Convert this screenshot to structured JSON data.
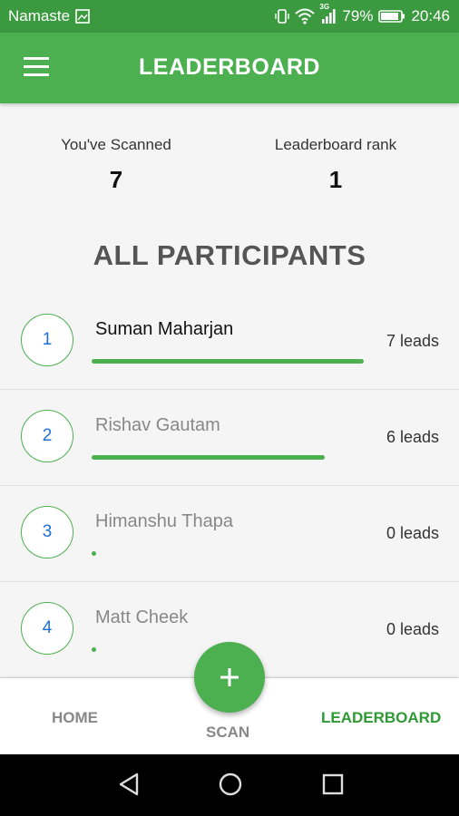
{
  "status_bar": {
    "carrier": "Namaste",
    "battery": "79%",
    "time": "20:46",
    "network_type": "3G"
  },
  "app_bar": {
    "title": "LEADERBOARD"
  },
  "stats": {
    "scanned_label": "You've Scanned",
    "scanned_value": "7",
    "rank_label": "Leaderboard rank",
    "rank_value": "1"
  },
  "section_title": "ALL PARTICIPANTS",
  "participants": [
    {
      "rank": "1",
      "name": "Suman Maharjan",
      "leads_text": "7 leads",
      "leads": 7
    },
    {
      "rank": "2",
      "name": "Rishav Gautam",
      "leads_text": "6 leads",
      "leads": 6
    },
    {
      "rank": "3",
      "name": "Himanshu Thapa",
      "leads_text": "0 leads",
      "leads": 0
    },
    {
      "rank": "4",
      "name": "Matt Cheek",
      "leads_text": "0 leads",
      "leads": 0
    }
  ],
  "bottom_nav": {
    "home": "HOME",
    "scan": "SCAN",
    "leaderboard": "LEADERBOARD"
  },
  "colors": {
    "primary": "#4caf50",
    "primary_dark": "#3b9a40",
    "active_tab": "#2e9a34",
    "rank_number": "#1e6fd9"
  },
  "icons": {
    "menu": "hamburger-menu-icon",
    "fab": "plus-icon",
    "back": "back-triangle-icon",
    "home": "home-circle-icon",
    "recents": "recents-square-icon"
  }
}
